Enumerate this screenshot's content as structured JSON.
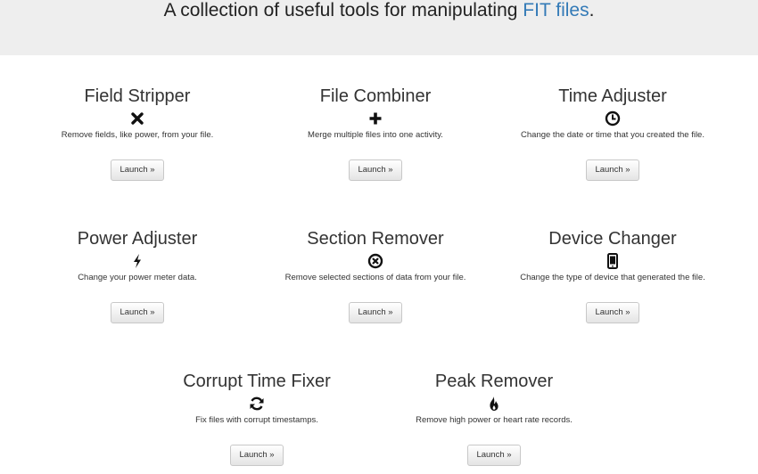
{
  "header": {
    "tagline_text": "A collection of useful tools for manipulating ",
    "tagline_link": "FIT files",
    "tagline_end": "."
  },
  "tools": [
    {
      "title": "Field Stripper",
      "icon": "x-icon",
      "description": "Remove fields, like power, from your file.",
      "button": "Launch »"
    },
    {
      "title": "File Combiner",
      "icon": "plus-icon",
      "description": "Merge multiple files into one activity.",
      "button": "Launch »"
    },
    {
      "title": "Time Adjuster",
      "icon": "clock-icon",
      "description": "Change the date or time that you created the file.",
      "button": "Launch »"
    },
    {
      "title": "Power Adjuster",
      "icon": "flash-icon",
      "description": "Change your power meter data.",
      "button": "Launch »"
    },
    {
      "title": "Section Remover",
      "icon": "remove-circle-icon",
      "description": "Remove selected sections of data from your file.",
      "button": "Launch »"
    },
    {
      "title": "Device Changer",
      "icon": "phone-icon",
      "description": "Change the type of device that generated the file.",
      "button": "Launch »"
    },
    {
      "title": "Corrupt Time Fixer",
      "icon": "refresh-icon",
      "description": "Fix files with corrupt timestamps.",
      "button": "Launch »"
    },
    {
      "title": "Peak Remover",
      "icon": "fire-icon",
      "description": "Remove high power or heart rate records.",
      "button": "Launch »"
    }
  ],
  "colors": {
    "hero_background": "#eeeeee",
    "link": "#337ab7",
    "text": "#333333"
  }
}
